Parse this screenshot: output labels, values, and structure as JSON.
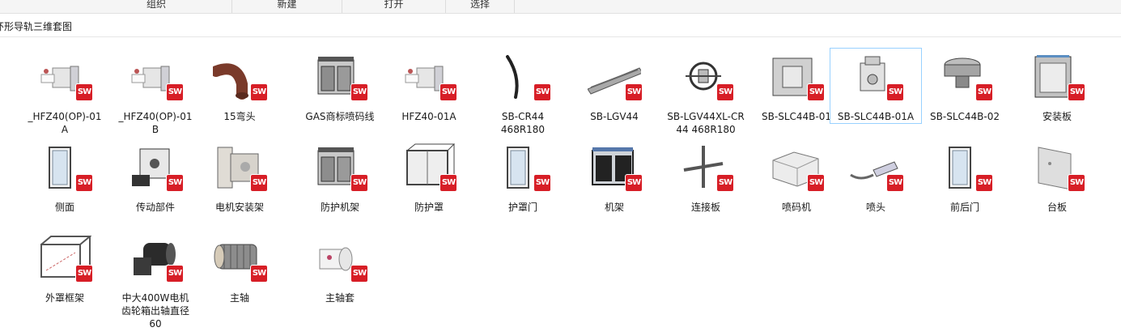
{
  "ribbon": {
    "groups": [
      "组织",
      "新建",
      "打开",
      "选择"
    ]
  },
  "address": {
    "path": "环形导轨三维套图"
  },
  "badge_text": "SW",
  "files": [
    {
      "name": "_HFZ40(OP)-01A",
      "icon": "cylinder-unit-icon"
    },
    {
      "name": "_HFZ40(OP)-01B",
      "icon": "cylinder-unit-icon"
    },
    {
      "name": "15弯头",
      "icon": "elbow-pipe-icon"
    },
    {
      "name": "GAS商标喷码线",
      "icon": "machine-cabinet-icon"
    },
    {
      "name": "HFZ40-01A",
      "icon": "cylinder-unit-icon"
    },
    {
      "name": "SB-CR44 468R180",
      "icon": "curved-rail-icon"
    },
    {
      "name": "SB-LGV44",
      "icon": "straight-rail-icon"
    },
    {
      "name": "SB-LGV44XL-CR44 468R180",
      "icon": "carriage-icon"
    },
    {
      "name": "SB-SLC44B-01",
      "icon": "block-icon"
    },
    {
      "name": "SB-SLC44B-01A",
      "icon": "carriage-block-icon",
      "selected": true
    },
    {
      "name": "SB-SLC44B-02",
      "icon": "roller-icon"
    },
    {
      "name": "安装板",
      "icon": "panel-box-icon"
    },
    {
      "name": "侧面",
      "icon": "door-frame-icon"
    },
    {
      "name": "传动部件",
      "icon": "drive-box-icon"
    },
    {
      "name": "电机安装架",
      "icon": "motor-bracket-icon"
    },
    {
      "name": "防护机架",
      "icon": "machine-cabinet-icon"
    },
    {
      "name": "防护罩",
      "icon": "guard-frame-icon"
    },
    {
      "name": "护罩门",
      "icon": "door-frame-icon"
    },
    {
      "name": "机架",
      "icon": "rack-frame-icon"
    },
    {
      "name": "连接板",
      "icon": "cross-plate-icon"
    },
    {
      "name": "喷码机",
      "icon": "printer-box-icon"
    },
    {
      "name": "喷头",
      "icon": "nozzle-icon"
    },
    {
      "name": "前后门",
      "icon": "door-frame-icon"
    },
    {
      "name": "台板",
      "icon": "table-plate-icon"
    },
    {
      "name": "外罩框架",
      "icon": "wire-frame-icon"
    },
    {
      "name": "中大400W电机齿轮箱出轴直径60",
      "icon": "gear-motor-icon"
    },
    {
      "name": "主轴",
      "icon": "spindle-icon"
    },
    {
      "name": "主轴套",
      "icon": "spindle-sleeve-icon"
    }
  ],
  "label_lines": [
    [
      "_HFZ40(OP)-01",
      "A"
    ],
    [
      "_HFZ40(OP)-01",
      "B"
    ],
    [
      "15弯头"
    ],
    [
      "GAS商标喷码线"
    ],
    [
      "HFZ40-01A"
    ],
    [
      "SB-CR44",
      "468R180"
    ],
    [
      "SB-LGV44"
    ],
    [
      "SB-LGV44XL-CR",
      "44 468R180"
    ],
    [
      "SB-SLC44B-01"
    ],
    [
      "SB-SLC44B-01A"
    ],
    [
      "SB-SLC44B-02"
    ],
    [
      "安装板"
    ],
    [
      "侧面"
    ],
    [
      "传动部件"
    ],
    [
      "电机安装架"
    ],
    [
      "防护机架"
    ],
    [
      "防护罩"
    ],
    [
      "护罩门"
    ],
    [
      "机架"
    ],
    [
      "连接板"
    ],
    [
      "喷码机"
    ],
    [
      "喷头"
    ],
    [
      "前后门"
    ],
    [
      "台板"
    ],
    [
      "外罩框架"
    ],
    [
      "中大400W电机",
      "齿轮箱出轴直径",
      "60"
    ],
    [
      "主轴"
    ],
    [
      "主轴套"
    ]
  ]
}
